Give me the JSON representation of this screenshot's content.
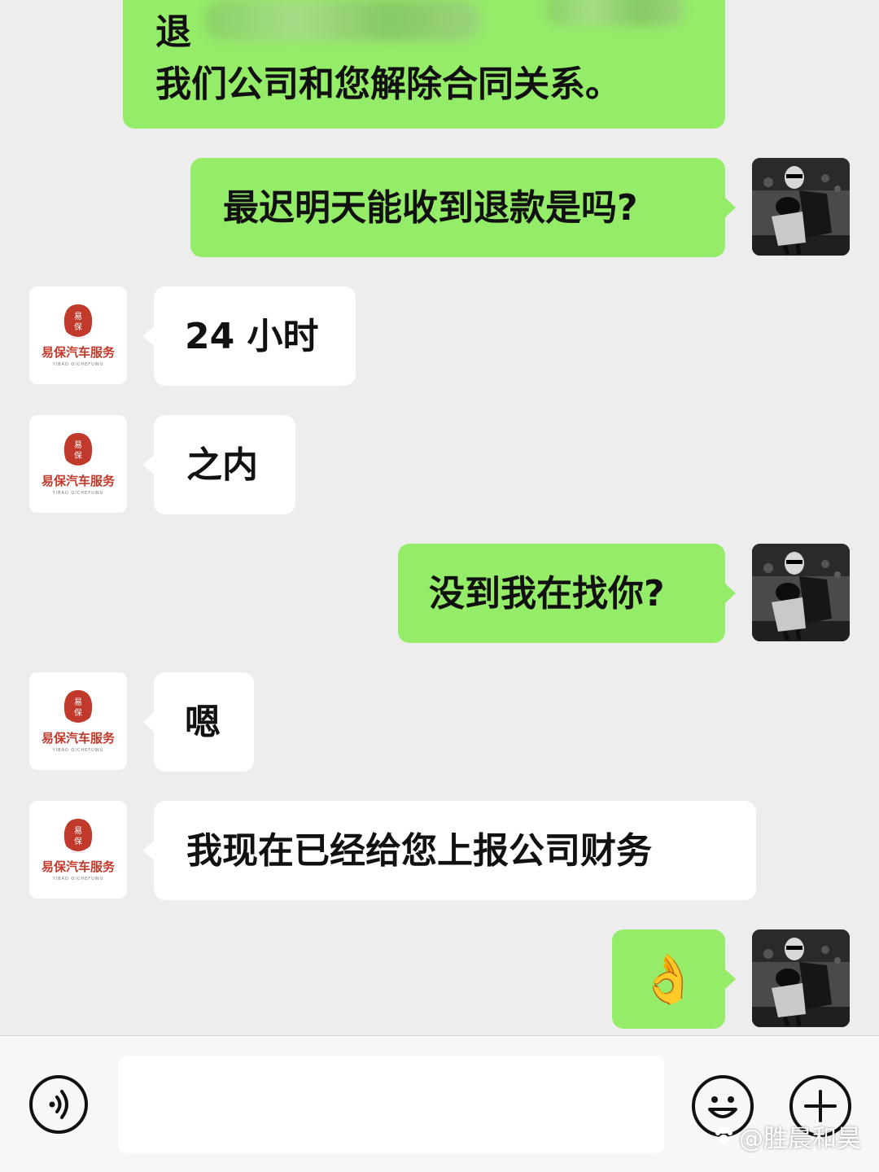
{
  "colors": {
    "background": "#ededed",
    "sent_bubble": "#95ec69",
    "received_bubble": "#ffffff",
    "brand_red": "#c0392b"
  },
  "messages": [
    {
      "side": "sent",
      "lines": [
        "退",
        "我们公司和您解除合同关系。"
      ],
      "redacted": true
    },
    {
      "side": "sent",
      "text": "最迟明天能收到退款是吗?"
    },
    {
      "side": "received",
      "text": "24 小时"
    },
    {
      "side": "received",
      "text": "之内"
    },
    {
      "side": "sent",
      "text": "没到我在找你?"
    },
    {
      "side": "received",
      "text": "嗯"
    },
    {
      "side": "received",
      "text": "我现在已经给您上报公司财务"
    },
    {
      "side": "sent",
      "emoji": "ok-hand-emoji",
      "text": "👌"
    }
  ],
  "company_avatar": {
    "seal_text": "易保",
    "name": "易保汽车服务",
    "romanized": "YIBAO QICHEFUWU",
    "icon": "red-seal-logo"
  },
  "user_avatar": {
    "icon": "user-photo-avatar"
  },
  "input_bar": {
    "voice_icon": "voice-icon",
    "emoji_icon": "emoji-icon",
    "plus_icon": "plus-icon",
    "input_value": ""
  },
  "watermark": {
    "text": "@胜晨和昊"
  }
}
